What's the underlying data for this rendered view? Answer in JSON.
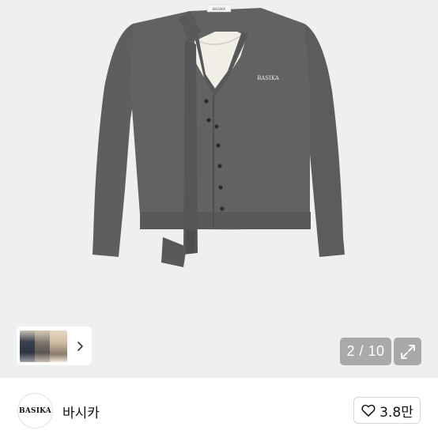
{
  "product_image": {
    "label_text": "BASIKA",
    "neck_label_text": "BASIKA",
    "colors": {
      "background": "#eeeff0",
      "knit": "#5f6062",
      "camisole": "#f2efe9"
    }
  },
  "thumbnails": {
    "chevron_icon": "chevron-right-icon"
  },
  "gallery": {
    "page_counter": "2 / 10",
    "expand_icon": "expand-arrows-icon"
  },
  "seller": {
    "avatar_text": "BASIKA",
    "name": "바시카"
  },
  "like": {
    "icon": "heart-outline-icon",
    "count": "3.8만"
  }
}
